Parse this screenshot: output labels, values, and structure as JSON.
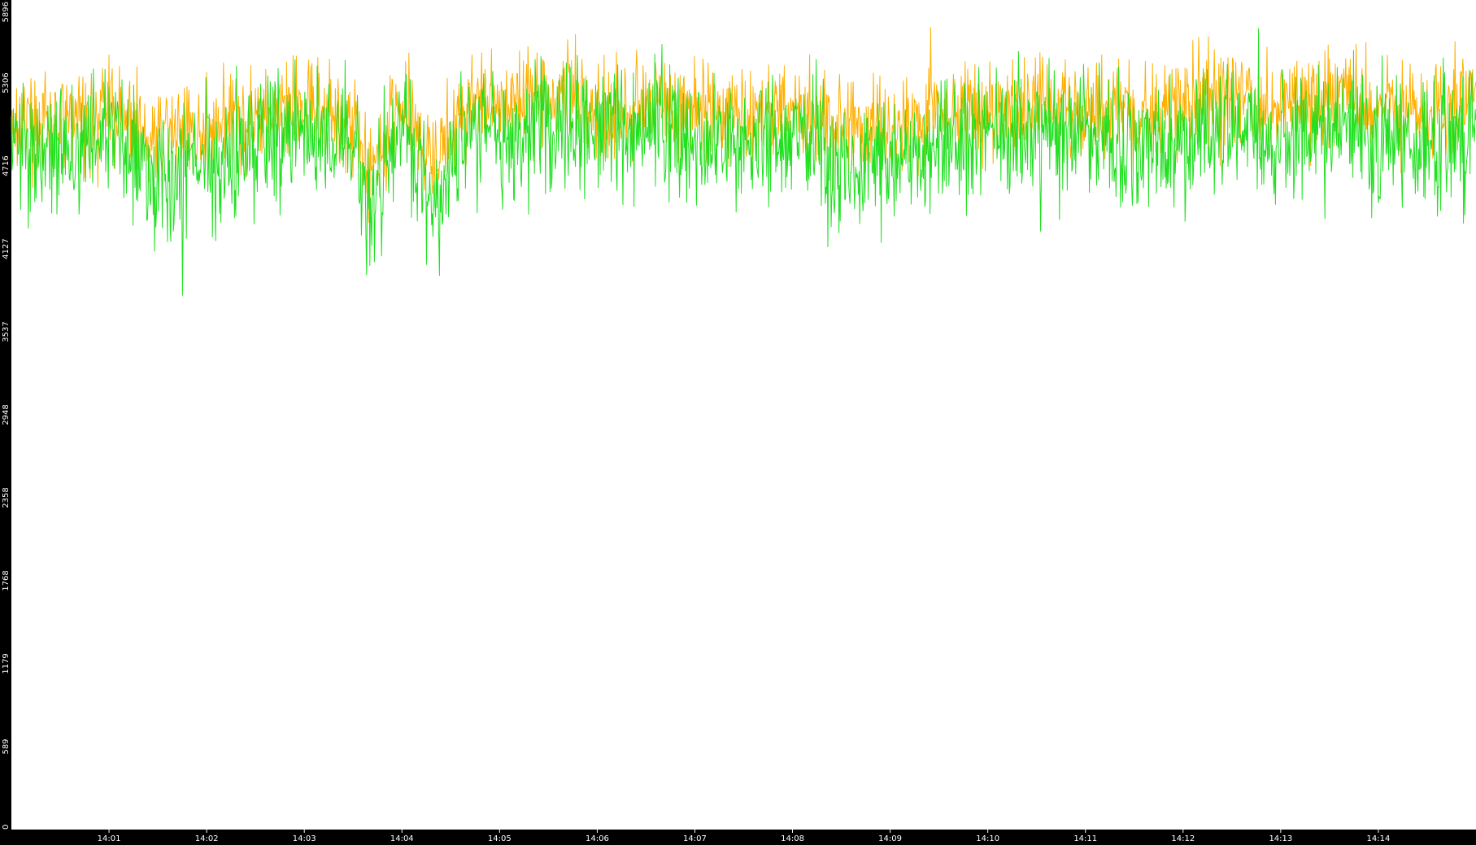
{
  "chart_data": {
    "type": "line",
    "title": "",
    "xlabel": "",
    "ylabel": "",
    "ylim": [
      0,
      5896
    ],
    "y_ticks": [
      "0",
      "589",
      "1179",
      "1768",
      "2358",
      "2948",
      "3537",
      "4127",
      "4716",
      "5306",
      "5896"
    ],
    "x_ticks": [
      "14:01",
      "14:02",
      "14:03",
      "14:04",
      "14:05",
      "14:06",
      "14:07",
      "14:08",
      "14:09",
      "14:10",
      "14:11",
      "14:12",
      "14:13",
      "14:14"
    ],
    "x_range": [
      "14:00:00",
      "14:15:00"
    ],
    "grid": false,
    "legend": "none",
    "background": "#ffffff",
    "frame_color": "#000000",
    "series": [
      {
        "color": "#ffb000",
        "t": [
          "14:00",
          "14:00:30",
          "14:01",
          "14:01:30",
          "14:02",
          "14:02:30",
          "14:03",
          "14:03:30",
          "14:03:40",
          "14:04",
          "14:04:20",
          "14:04:40",
          "14:05",
          "14:05:30",
          "14:06",
          "14:06:30",
          "14:07",
          "14:07:30",
          "14:08",
          "14:08:30",
          "14:09",
          "14:09:30",
          "14:10",
          "14:10:30",
          "14:11",
          "14:11:30",
          "14:12",
          "14:12:30",
          "14:13",
          "14:13:30",
          "14:14",
          "14:14:30",
          "14:15"
        ],
        "values": [
          5040,
          5010,
          5100,
          4900,
          5000,
          5080,
          5130,
          5030,
          4700,
          5180,
          4750,
          5150,
          5180,
          5230,
          5100,
          5120,
          5150,
          5070,
          5100,
          4980,
          4970,
          5080,
          5130,
          5120,
          5130,
          5070,
          5160,
          5220,
          5140,
          5210,
          5140,
          5100,
          5210
        ]
      },
      {
        "color": "#20e020",
        "t": [
          "14:00",
          "14:00:30",
          "14:01",
          "14:01:30",
          "14:02",
          "14:02:30",
          "14:03",
          "14:03:30",
          "14:03:40",
          "14:04",
          "14:04:20",
          "14:04:40",
          "14:05",
          "14:05:30",
          "14:06",
          "14:06:30",
          "14:07",
          "14:07:30",
          "14:08",
          "14:08:30",
          "14:09",
          "14:09:30",
          "14:10",
          "14:10:30",
          "14:11",
          "14:11:30",
          "14:12",
          "14:12:30",
          "14:13",
          "14:13:30",
          "14:14",
          "14:14:30",
          "14:15"
        ],
        "values": [
          4880,
          4820,
          4960,
          4680,
          4760,
          4850,
          4960,
          4820,
          4400,
          5050,
          4350,
          5000,
          4950,
          5040,
          4980,
          5020,
          4900,
          4820,
          4940,
          4720,
          4720,
          4850,
          4960,
          4880,
          4920,
          4800,
          4950,
          5060,
          4870,
          4990,
          4920,
          4830,
          4960
        ]
      }
    ]
  }
}
